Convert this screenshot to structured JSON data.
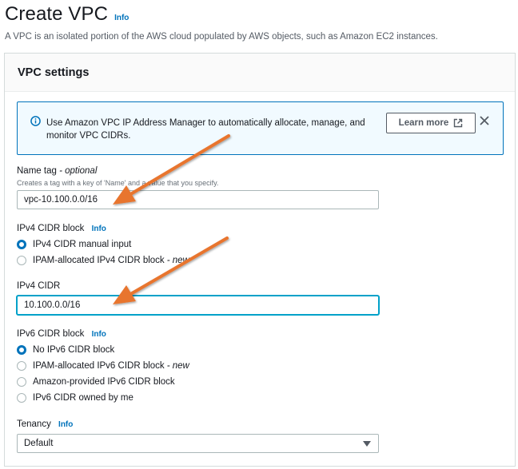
{
  "header": {
    "title": "Create VPC",
    "info": "Info",
    "description": "A VPC is an isolated portion of the AWS cloud populated by AWS objects, such as Amazon EC2 instances."
  },
  "panel": {
    "title": "VPC settings",
    "alert": {
      "icon": "info-circle-icon",
      "text": "Use Amazon VPC IP Address Manager to automatically allocate, manage, and monitor VPC CIDRs.",
      "button_label": "Learn more",
      "button_icon": "external-link-icon",
      "close_icon": "close-icon"
    },
    "name_tag": {
      "label": "Name tag",
      "optional": "- optional",
      "description": "Creates a tag with a key of 'Name' and a value that you specify.",
      "value": "vpc-10.100.0.0/16"
    },
    "ipv4_block": {
      "label": "IPv4 CIDR block",
      "info": "Info",
      "options": [
        {
          "label": "IPv4 CIDR manual input",
          "suffix": "",
          "checked": true
        },
        {
          "label": "IPAM-allocated IPv4 CIDR block",
          "suffix": "- new",
          "checked": false
        }
      ]
    },
    "ipv4_cidr": {
      "label": "IPv4 CIDR",
      "value": "10.100.0.0/16"
    },
    "ipv6_block": {
      "label": "IPv6 CIDR block",
      "info": "Info",
      "options": [
        {
          "label": "No IPv6 CIDR block",
          "suffix": "",
          "checked": true
        },
        {
          "label": "IPAM-allocated IPv6 CIDR block",
          "suffix": "- new",
          "checked": false
        },
        {
          "label": "Amazon-provided IPv6 CIDR block",
          "suffix": "",
          "checked": false
        },
        {
          "label": "IPv6 CIDR owned by me",
          "suffix": "",
          "checked": false
        }
      ]
    },
    "tenancy": {
      "label": "Tenancy",
      "info": "Info",
      "selected": "Default"
    }
  },
  "colors": {
    "link": "#0073bb",
    "alert_bg": "#f1faff",
    "focus": "#00a1c9",
    "annotation_arrow": "#e8742f"
  }
}
